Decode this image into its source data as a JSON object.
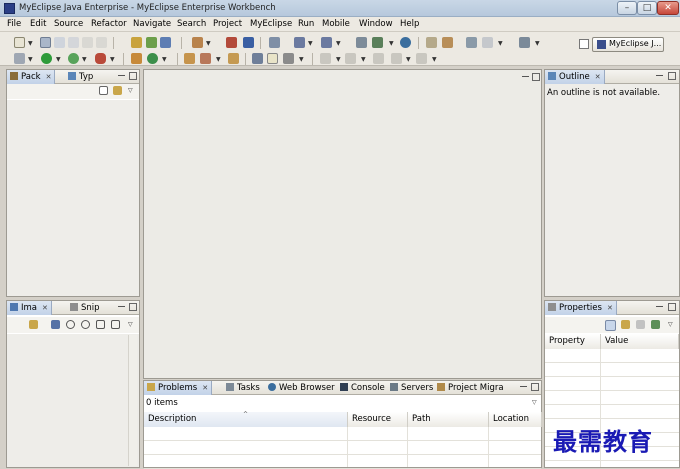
{
  "window": {
    "title": "MyEclipse Java Enterprise - MyEclipse Enterprise Workbench",
    "min_glyph": "–",
    "max_glyph": "□",
    "close_glyph": "✕"
  },
  "menu": [
    "File",
    "Edit",
    "Source",
    "Refactor",
    "Navigate",
    "Search",
    "Project",
    "MyEclipse",
    "Run",
    "Mobile",
    "Window",
    "Help"
  ],
  "perspective": {
    "label": "MyEclipse J..."
  },
  "left_top_panel": {
    "tabs": [
      {
        "label": "Pack"
      },
      {
        "label": "Typ"
      }
    ]
  },
  "left_bottom_panel": {
    "tabs": [
      {
        "label": "Ima"
      },
      {
        "label": "Snip"
      }
    ]
  },
  "outline_panel": {
    "tab": "Outline",
    "message": "An outline is not available."
  },
  "properties_panel": {
    "tab": "Properties",
    "columns": [
      "Property",
      "Value"
    ]
  },
  "bottom_panel": {
    "tabs": [
      {
        "label": "Problems"
      },
      {
        "label": "Tasks"
      },
      {
        "label": "Web Browser"
      },
      {
        "label": "Console"
      },
      {
        "label": "Servers"
      },
      {
        "label": "Project Migra"
      }
    ],
    "count": "0 items",
    "columns": [
      "Description",
      "Resource",
      "Path",
      "Location"
    ]
  },
  "watermark": "最需教育",
  "colors": {
    "accent_tab": "#c2d2e8",
    "watermark": "#1a1ab4"
  }
}
